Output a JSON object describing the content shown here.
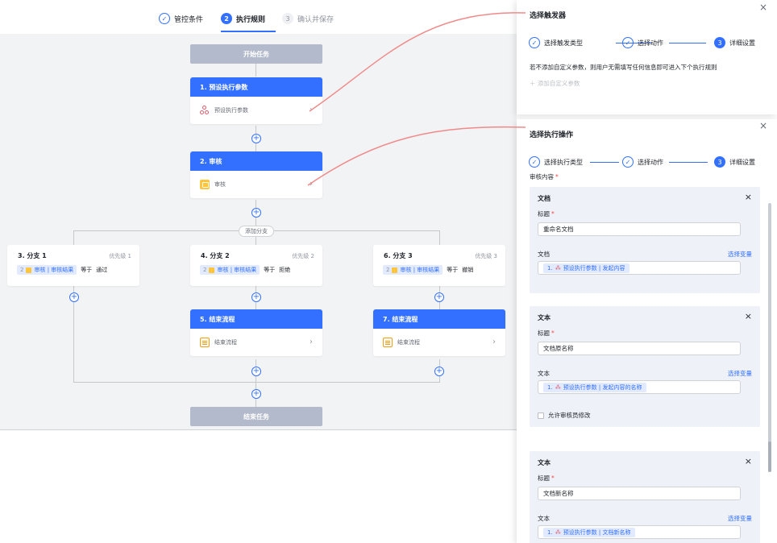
{
  "steps": [
    {
      "num": "✓",
      "label": "管控条件"
    },
    {
      "num": "2",
      "label": "执行规则"
    },
    {
      "num": "3",
      "label": "确认并保存"
    }
  ],
  "flow": {
    "start": "开始任务",
    "end": "结束任务",
    "node1": {
      "title": "1. 预设执行参数",
      "body": "预设执行参数"
    },
    "node2": {
      "title": "2. 审核",
      "body": "审核"
    },
    "add_branch": "添加分支",
    "branches": [
      {
        "title": "3. 分支 1",
        "priority": "优先级 1",
        "tag_num": "2",
        "tag": "审核 | 审核结果",
        "op": "等于",
        "value": "通过"
      },
      {
        "title": "4. 分支 2",
        "priority": "优先级 2",
        "tag_num": "2",
        "tag": "审核 | 审核结果",
        "op": "等于",
        "value": "拒绝"
      },
      {
        "title": "6. 分支 3",
        "priority": "优先级 3",
        "tag_num": "2",
        "tag": "审核 | 审核结果",
        "op": "等于",
        "value": "撤销"
      }
    ],
    "node5": {
      "title": "5. 结束流程",
      "body": "结束流程"
    },
    "node7": {
      "title": "7. 结束流程",
      "body": "结束流程"
    }
  },
  "trigger_panel": {
    "title": "选择触发器",
    "close": "×",
    "steps": [
      "选择触发类型",
      "选择动作",
      "详细设置"
    ],
    "step3_num": "3",
    "hint": "若不添加自定义参数，则用户无需填写任何信息即可进入下个执行规则",
    "add_param": "＋ 添加自定义参数"
  },
  "action_panel": {
    "title": "选择执行操作",
    "close": "×",
    "steps": [
      "选择执行类型",
      "选择动作",
      "详细设置"
    ],
    "step3_num": "3",
    "review_label": "审核内容",
    "required": "*",
    "select_var": "选择变量",
    "sections": [
      {
        "type": "文档",
        "title_label": "标题",
        "title_value": "重命名文档",
        "content_label": "文档",
        "var_num": "1.",
        "var": "预设执行参数 | 发起内容"
      },
      {
        "type": "文本",
        "title_label": "标题",
        "title_value": "文档原名称",
        "content_label": "文本",
        "var_num": "1.",
        "var": "预设执行参数 | 发起内容的名称",
        "checkbox": "允许审核员修改"
      },
      {
        "type": "文本",
        "title_label": "标题",
        "title_value": "文档新名称",
        "content_label": "文本",
        "var_num": "1.",
        "var": "预设执行参数 | 文档新名称"
      }
    ]
  },
  "colors": {
    "primary": "#3370ff",
    "terminal": "#b3bacb",
    "connector": "#f08a8a",
    "canvas": "#f2f3f5"
  }
}
